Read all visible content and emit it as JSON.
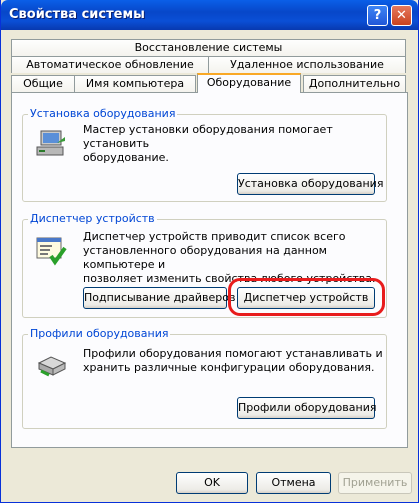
{
  "window": {
    "title": "Свойства системы",
    "help_button": "?",
    "close_button": "✕"
  },
  "tabs": {
    "row1": [
      "Восстановление системы"
    ],
    "row2": [
      "Автоматическое обновление",
      "Удаленное использование"
    ],
    "row3": [
      "Общие",
      "Имя компьютера",
      "Оборудование",
      "Дополнительно"
    ],
    "active": "Оборудование"
  },
  "hardware_wizard": {
    "title": "Установка оборудования",
    "text_line1": "Мастер установки оборудования помогает установить",
    "text_line2": "оборудование.",
    "button": "Установка оборудования",
    "icon": "hardware-wizard-icon"
  },
  "device_manager": {
    "title": "Диспетчер устройств",
    "text_line1": "Диспетчер устройств приводит список всего",
    "text_line2": "установленного оборудования на данном компьютере и",
    "text_line3": "позволяет изменить свойства любого устройства.",
    "signing_button": "Подписывание драйверов",
    "manager_button": "Диспетчер устройств",
    "icon": "device-manager-icon"
  },
  "hardware_profiles": {
    "title": "Профили оборудования",
    "text_line1": "Профили оборудования помогают устанавливать и",
    "text_line2": "хранить различные конфигурации оборудования.",
    "button": "Профили оборудования",
    "icon": "hardware-profiles-icon"
  },
  "footer": {
    "ok": "OK",
    "cancel": "Отмена",
    "apply": "Применить"
  },
  "colors": {
    "titlebar": "#0a4fd6",
    "group_title": "#0046d5",
    "highlight": "#e81c1c",
    "active_tab_accent": "#f9a825"
  }
}
